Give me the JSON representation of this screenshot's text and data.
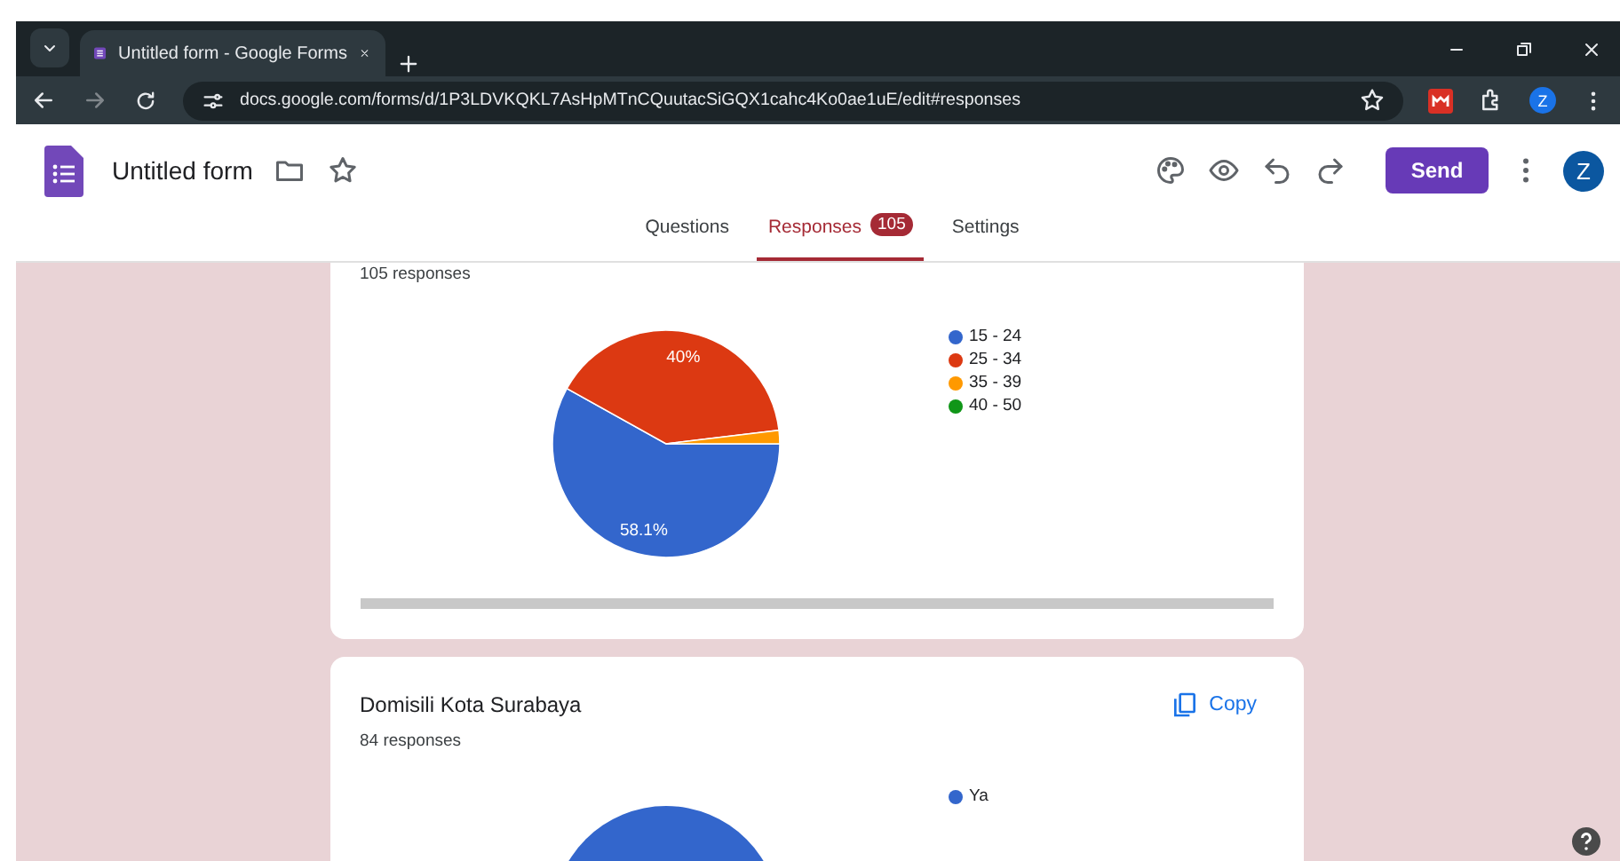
{
  "browser": {
    "tab_title": "Untitled form - Google Forms",
    "url": "docs.google.com/forms/d/1P3LDVKQKL7AsHpMTnCQuutacSiGQX1cahc4Ko0ae1uE/edit#responses",
    "profile_initial": "Z"
  },
  "form_header": {
    "title": "Untitled form",
    "send_label": "Send",
    "avatar_initial": "Z"
  },
  "tabs": [
    {
      "label": "Questions",
      "selected": false
    },
    {
      "label": "Responses",
      "selected": true,
      "badge": "105"
    },
    {
      "label": "Settings",
      "selected": false
    }
  ],
  "cards": [
    {
      "responses": "105 responses",
      "chart_data": {
        "type": "pie",
        "categories": [
          "15 - 24",
          "25 - 34",
          "35 - 39",
          "40 - 50"
        ],
        "values": [
          58.1,
          40,
          1.9,
          0
        ],
        "colors": [
          "#3366cc",
          "#dc3912",
          "#ff9900",
          "#109618"
        ],
        "value_labels": [
          "58.1%",
          "40%",
          null,
          null
        ]
      }
    },
    {
      "title": "Domisili Kota Surabaya",
      "copy_label": "Copy",
      "responses": "84 responses",
      "chart_data": {
        "type": "pie",
        "categories": [
          "Ya"
        ],
        "values": [
          100
        ],
        "colors": [
          "#3366cc"
        ]
      }
    }
  ]
}
